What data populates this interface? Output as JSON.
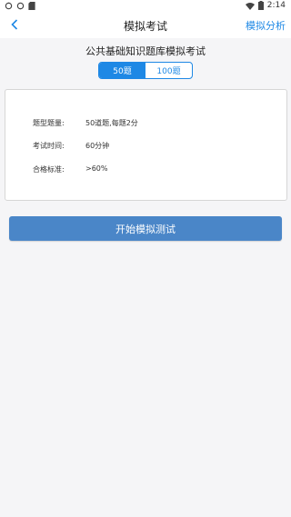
{
  "status_bar": {
    "time": "2:14",
    "left_icons": [
      "sync-icon",
      "sync-icon",
      "sd-card-icon"
    ],
    "right_icons": [
      "wifi-icon",
      "battery-icon"
    ]
  },
  "app_bar": {
    "title": "模拟考试",
    "action_label": "模拟分析",
    "back_icon": "chevron-left-icon"
  },
  "subject_title": "公共基础知识题库模拟考试",
  "question_count_tabs": [
    {
      "label": "50题",
      "active": true
    },
    {
      "label": "100题",
      "active": false
    }
  ],
  "info": {
    "rows": [
      {
        "label": "题型题量:",
        "value": "50道题,每题2分"
      },
      {
        "label": "考试时间:",
        "value": "60分钟"
      },
      {
        "label": "合格标准:",
        "value": ">60%"
      }
    ]
  },
  "start_button_label": "开始模拟测试",
  "colors": {
    "accent": "#1e88e5",
    "button": "#4a86c8",
    "background": "#f5f5f7"
  }
}
